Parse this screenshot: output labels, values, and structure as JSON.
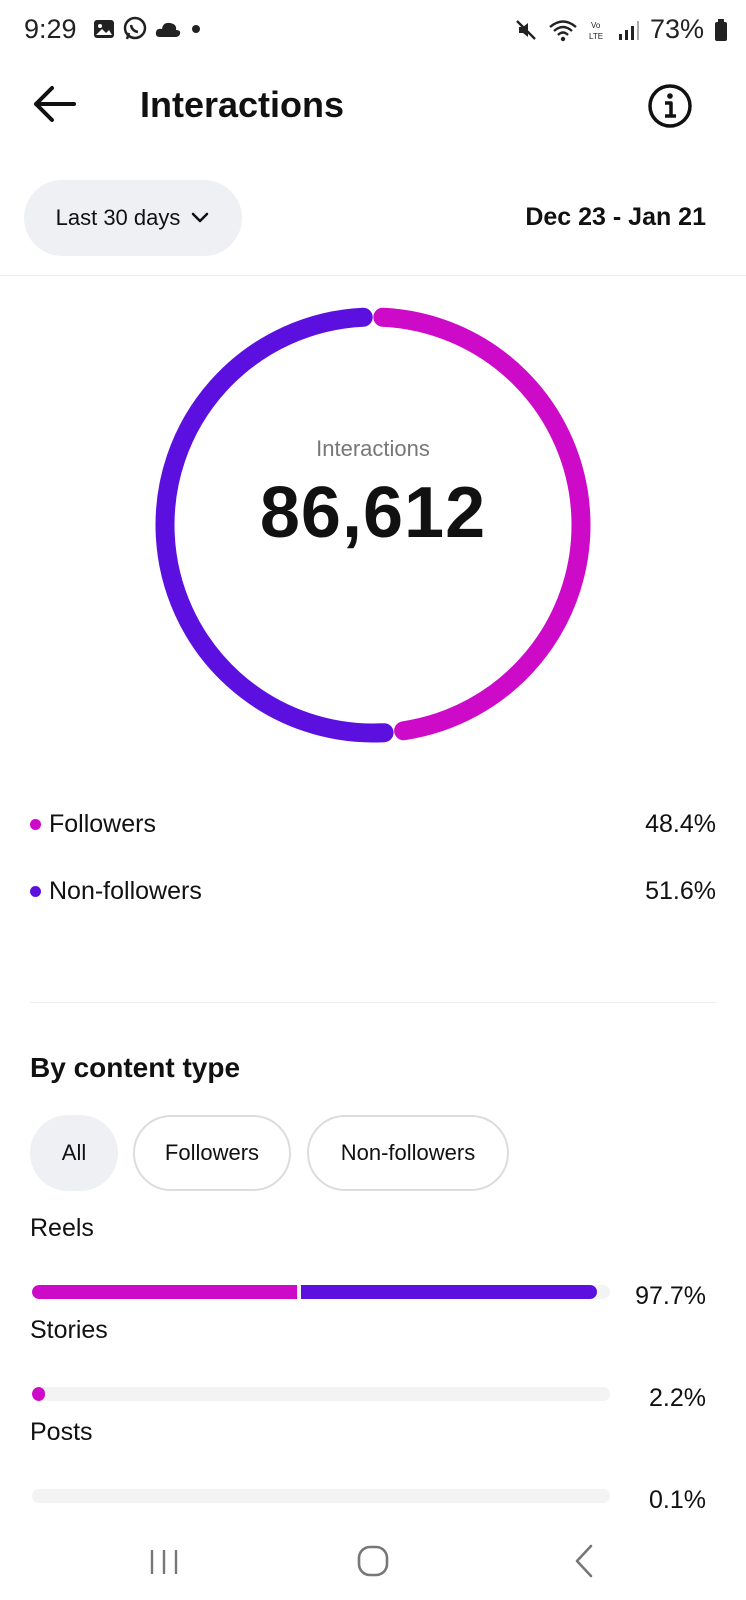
{
  "status_bar": {
    "time": "9:29",
    "battery": "73%",
    "left_icons": [
      "image-icon",
      "whatsapp-icon",
      "cloud-icon",
      "dot-icon"
    ],
    "right_icons": [
      "mute-icon",
      "wifi-icon",
      "volte-icon",
      "signal-icon",
      "battery-icon"
    ]
  },
  "header": {
    "title": "Interactions",
    "back_icon": "back-arrow-icon",
    "info_icon": "info-icon"
  },
  "range": {
    "selector_label": "Last 30 days",
    "dates": "Dec 23 - Jan 21"
  },
  "summary": {
    "label": "Interactions",
    "value": "86,612"
  },
  "chart_data": {
    "type": "pie",
    "title": "",
    "series": [
      {
        "name": "Followers",
        "value": 48.4,
        "color": "#cc0ac8"
      },
      {
        "name": "Non-followers",
        "value": 51.6,
        "color": "#5b10e0"
      }
    ]
  },
  "legend": [
    {
      "label": "Followers",
      "value": "48.4%",
      "color": "#cc0ac8"
    },
    {
      "label": "Non-followers",
      "value": "51.6%",
      "color": "#5b10e0"
    }
  ],
  "content_type": {
    "title": "By content type",
    "chips": [
      "All",
      "Followers",
      "Non-followers"
    ],
    "active_chip": "All",
    "rows": [
      {
        "label": "Reels",
        "value": "97.7%",
        "total": 97.7,
        "followers_share": 0.47,
        "non_followers_share": 0.53
      },
      {
        "label": "Stories",
        "value": "2.2%",
        "total": 2.2,
        "followers_share": 1.0,
        "non_followers_share": 0.0
      },
      {
        "label": "Posts",
        "value": "0.1%",
        "total": 0.1,
        "followers_share": 0.0,
        "non_followers_share": 0.0
      }
    ]
  },
  "colors": {
    "followers": "#cc0ac8",
    "non_followers": "#5b10e0"
  },
  "nav_bar": {
    "icons": [
      "recent-apps-icon",
      "home-icon",
      "back-icon"
    ]
  }
}
